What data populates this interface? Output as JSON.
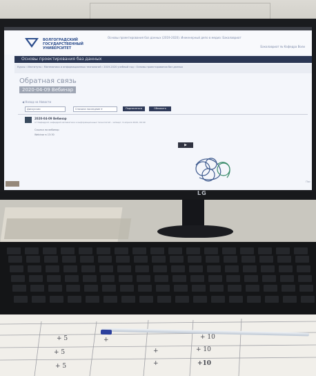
{
  "screen": {
    "header": {
      "university_name": "ВОЛГОГРАДСКИЙ ГОСУДАРСТВЕННЫЙ УНИВЕРСИТЕТ",
      "top_text": "Основы проектирования баз данных (2019-2020). Инженерный депо в медиа: Бакалавриат",
      "right_text": "Бакалавриат № Кафедра Воли"
    },
    "navbar_title": "Основы проектирования баз данных",
    "breadcrumb": "Курсы › Институты › Математики и информационных технологий › 2019-2020 учебный год › Основы проектирования баз данных",
    "page_title": "Обратная связь",
    "subtitle": "2020-04-09 Вебинар",
    "back_link": "◀ Назад на Новости",
    "filter_select": "Дискуссии",
    "sort_select": "Сначала последние ▾",
    "button_subscribe": "Подписаться",
    "button_search": "Обновить",
    "post": {
      "title": "2020-04-09 Вебинар",
      "meta": "от Кафедрой, кафедрой математики и информационных технологий - четверг, 9 апреля 2020, 09:49",
      "line1": "Ссылка на вебинар",
      "line2": "Webinar в 13:30"
    },
    "video_icon": "play-icon",
    "side_text": "Пос"
  },
  "monitor_brand": "LG",
  "notes": {
    "handwriting": [
      "+ 5",
      "+",
      "+ 5",
      "+ 10",
      "+ 5",
      "+10",
      "+",
      "+ 10",
      "+"
    ]
  },
  "colors": {
    "navbar": "#2b3754",
    "button": "#2f3a59",
    "pen_cap": "#2b3f9c"
  }
}
